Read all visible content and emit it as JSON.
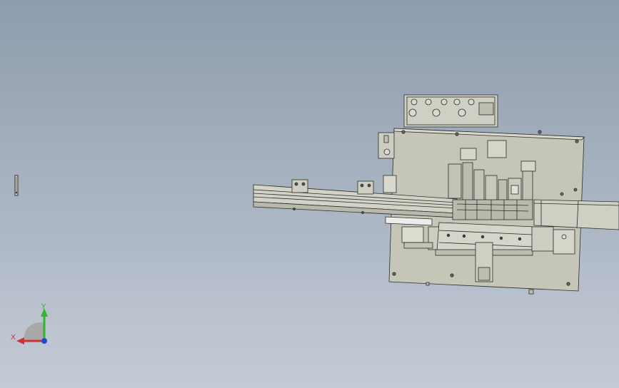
{
  "viewport": {
    "background_top": "#8e9cad",
    "background_bottom": "#c4cbd6"
  },
  "model": {
    "icon": "assembly-machine",
    "plate_color": "#c9c9bb",
    "line_color": "#2d2d2d"
  },
  "triad": {
    "x_label": "X",
    "y_label": "Y",
    "x_color": "#d23030",
    "y_color": "#2fb52f",
    "z_color": "#1f4bd1"
  }
}
